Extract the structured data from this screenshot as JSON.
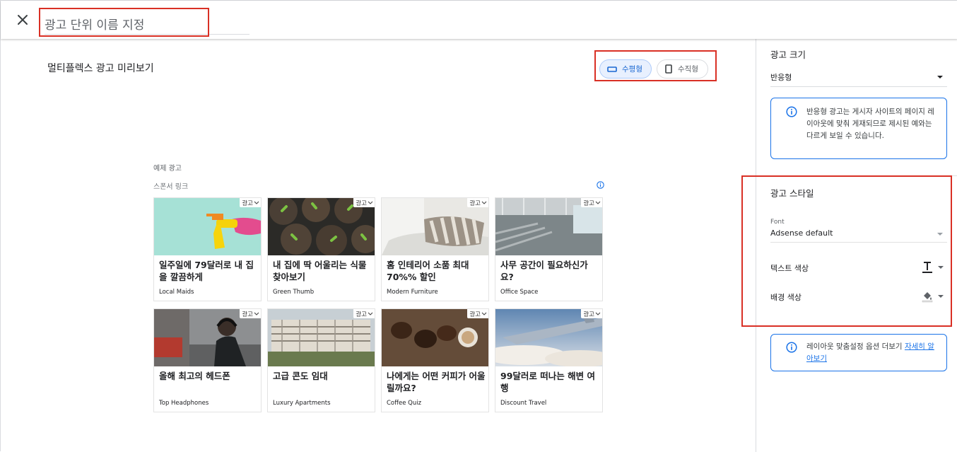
{
  "header": {
    "close_icon": "close-icon",
    "name_placeholder": "광고 단위 이름 지정"
  },
  "main": {
    "preview_title": "멀티플렉스 광고 미리보기",
    "orientation": {
      "horizontal_label": "수평형",
      "vertical_label": "수직형",
      "selected": "horizontal"
    },
    "sample_label": "예제 광고",
    "sponsored_label": "스폰서 링크",
    "ad_badge_label": "광고",
    "ads": [
      {
        "headline": "일주일에 79달러로 내 집을 깔끔하게",
        "advertiser": "Local Maids",
        "image": "spray-bottle"
      },
      {
        "headline": "내 집에 딱 어울리는 식물 찾아보기",
        "advertiser": "Green Thumb",
        "image": "seedling-pots"
      },
      {
        "headline": "홈 인테리어 소품 최대 70%% 할인",
        "advertiser": "Modern Furniture",
        "image": "bedroom-pillows"
      },
      {
        "headline": "사무 공간이 필요하신가요?",
        "advertiser": "Office Space",
        "image": "office-interior"
      },
      {
        "headline": "올해 최고의 헤드폰",
        "advertiser": "Top Headphones",
        "image": "person-headphones"
      },
      {
        "headline": "고급 콘도 임대",
        "advertiser": "Luxury Apartments",
        "image": "condo-building"
      },
      {
        "headline": "나에게는 어떤 커피가 어울릴까요?",
        "advertiser": "Coffee Quiz",
        "image": "coffee-beans"
      },
      {
        "headline": "99달러로 떠나는 해변 여행",
        "advertiser": "Discount Travel",
        "image": "airplane-wing"
      }
    ]
  },
  "side": {
    "ad_size_title": "광고 크기",
    "ad_size_value": "반응형",
    "responsive_info": "반응형 광고는 게시자 사이트의 페이지 레이아웃에 맞춰 게재되므로 제시된 예와는 다르게 보일 수 있습니다.",
    "ad_style_title": "광고 스타일",
    "font_label": "Font",
    "font_value": "Adsense default",
    "text_color_label": "텍스트 색상",
    "bg_color_label": "배경 색상",
    "layout_info_text": "레이아웃 맞춤설정 옵션 더보기 ",
    "layout_info_link": "자세히 알아보기"
  },
  "colors": {
    "accent": "#1a73e8",
    "highlight_box": "#d93025",
    "selected_chip_bg": "#e8f0fe"
  }
}
